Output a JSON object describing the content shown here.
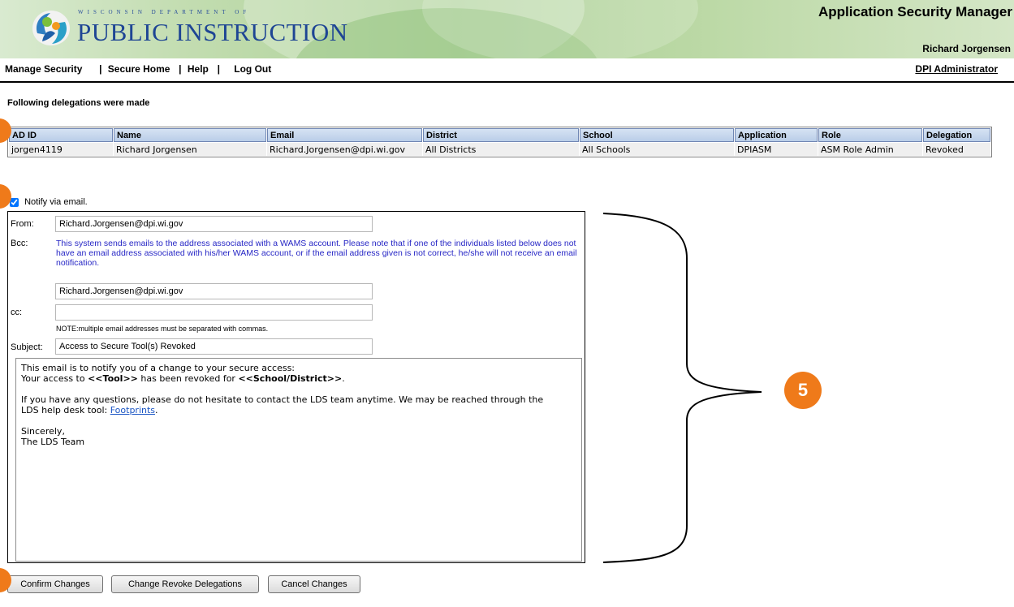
{
  "header": {
    "logo_top": "WISCONSIN DEPARTMENT OF",
    "logo_main": "PUBLIC INSTRUCTION",
    "app_title": "Application Security Manager",
    "user_name": "Richard  Jorgensen"
  },
  "nav": {
    "items": [
      {
        "label": "Manage Security"
      },
      {
        "label": "Secure Home"
      },
      {
        "label": "Help"
      },
      {
        "label": "Log Out"
      }
    ],
    "separator": "|",
    "role_link": "DPI Administrator"
  },
  "delegations": {
    "heading": "Following delegations were made",
    "columns": [
      "AD ID",
      "Name",
      "Email",
      "District",
      "School",
      "Application",
      "Role",
      "Delegation"
    ],
    "rows": [
      [
        "jorgen4119",
        "Richard Jorgensen",
        "Richard.Jorgensen@dpi.wi.gov",
        "All Districts",
        "All Schools",
        "DPIASM",
        "ASM Role Admin",
        "Revoked"
      ]
    ]
  },
  "notify": {
    "label": "Notify via email.",
    "checked": true
  },
  "email": {
    "from_label": "From:",
    "from_value": "Richard.Jorgensen@dpi.wi.gov",
    "bcc_label": "Bcc:",
    "bcc_note": "This system sends emails to the address associated with a WAMS account. Please note that if one of the individuals listed below does not have an email address associated with his/her WAMS account, or if the email address given is not correct, he/she will not receive an email notification.",
    "bcc_value": "Richard.Jorgensen@dpi.wi.gov",
    "cc_label": "cc:",
    "cc_value": "",
    "cc_note": "NOTE:multiple email addresses must be separated with commas.",
    "subject_label": "Subject:",
    "subject_value": "Access to Secure Tool(s) Revoked",
    "body": {
      "line1": "This email is to notify you of a change to your secure access:",
      "line2_pre": "Your access to ",
      "line2_tool": "<<Tool>>",
      "line2_mid": " has been revoked for ",
      "line2_place": "<<School/District>>",
      "line2_end": ".",
      "line3": "If you have any questions, please do not hesitate to contact the LDS team anytime. We may be reached through the",
      "line4_pre": "LDS help desk tool: ",
      "link": "Footprints",
      "line4_end": ".",
      "closing": "Sincerely,",
      "signature": "The LDS Team"
    }
  },
  "buttons": {
    "confirm": "Confirm Changes",
    "change_revoke": "Change Revoke Delegations",
    "cancel": "Cancel Changes"
  },
  "callouts": {
    "five": "5"
  },
  "colors": {
    "header_green": "#a9cf93",
    "logo_blue": "#1e4594",
    "bcc_note_blue": "#2626c5",
    "callout_orange": "#ef7a1a",
    "table_header": "#c6d7ee"
  }
}
